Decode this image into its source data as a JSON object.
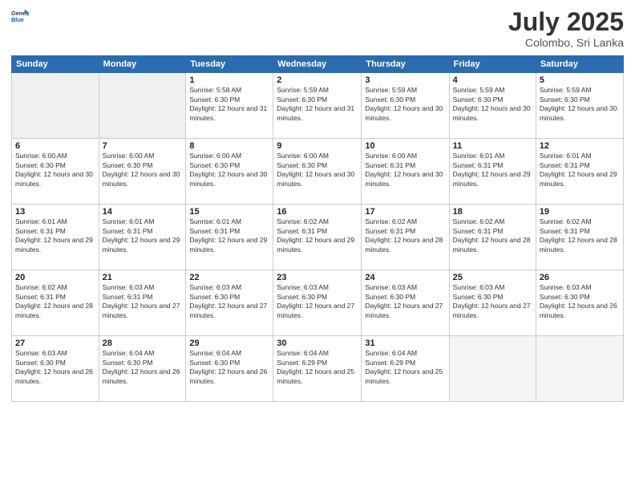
{
  "header": {
    "logo_general": "General",
    "logo_blue": "Blue",
    "month_title": "July 2025",
    "location": "Colombo, Sri Lanka"
  },
  "weekdays": [
    "Sunday",
    "Monday",
    "Tuesday",
    "Wednesday",
    "Thursday",
    "Friday",
    "Saturday"
  ],
  "weeks": [
    [
      {
        "day": "",
        "info": "",
        "empty": true
      },
      {
        "day": "",
        "info": "",
        "empty": true
      },
      {
        "day": "1",
        "info": "Sunrise: 5:58 AM\nSunset: 6:30 PM\nDaylight: 12 hours and 31 minutes."
      },
      {
        "day": "2",
        "info": "Sunrise: 5:59 AM\nSunset: 6:30 PM\nDaylight: 12 hours and 31 minutes."
      },
      {
        "day": "3",
        "info": "Sunrise: 5:59 AM\nSunset: 6:30 PM\nDaylight: 12 hours and 30 minutes."
      },
      {
        "day": "4",
        "info": "Sunrise: 5:59 AM\nSunset: 6:30 PM\nDaylight: 12 hours and 30 minutes."
      },
      {
        "day": "5",
        "info": "Sunrise: 5:59 AM\nSunset: 6:30 PM\nDaylight: 12 hours and 30 minutes."
      }
    ],
    [
      {
        "day": "6",
        "info": "Sunrise: 6:00 AM\nSunset: 6:30 PM\nDaylight: 12 hours and 30 minutes."
      },
      {
        "day": "7",
        "info": "Sunrise: 6:00 AM\nSunset: 6:30 PM\nDaylight: 12 hours and 30 minutes."
      },
      {
        "day": "8",
        "info": "Sunrise: 6:00 AM\nSunset: 6:30 PM\nDaylight: 12 hours and 30 minutes."
      },
      {
        "day": "9",
        "info": "Sunrise: 6:00 AM\nSunset: 6:30 PM\nDaylight: 12 hours and 30 minutes."
      },
      {
        "day": "10",
        "info": "Sunrise: 6:00 AM\nSunset: 6:31 PM\nDaylight: 12 hours and 30 minutes."
      },
      {
        "day": "11",
        "info": "Sunrise: 6:01 AM\nSunset: 6:31 PM\nDaylight: 12 hours and 29 minutes."
      },
      {
        "day": "12",
        "info": "Sunrise: 6:01 AM\nSunset: 6:31 PM\nDaylight: 12 hours and 29 minutes."
      }
    ],
    [
      {
        "day": "13",
        "info": "Sunrise: 6:01 AM\nSunset: 6:31 PM\nDaylight: 12 hours and 29 minutes."
      },
      {
        "day": "14",
        "info": "Sunrise: 6:01 AM\nSunset: 6:31 PM\nDaylight: 12 hours and 29 minutes."
      },
      {
        "day": "15",
        "info": "Sunrise: 6:01 AM\nSunset: 6:31 PM\nDaylight: 12 hours and 29 minutes."
      },
      {
        "day": "16",
        "info": "Sunrise: 6:02 AM\nSunset: 6:31 PM\nDaylight: 12 hours and 29 minutes."
      },
      {
        "day": "17",
        "info": "Sunrise: 6:02 AM\nSunset: 6:31 PM\nDaylight: 12 hours and 28 minutes."
      },
      {
        "day": "18",
        "info": "Sunrise: 6:02 AM\nSunset: 6:31 PM\nDaylight: 12 hours and 28 minutes."
      },
      {
        "day": "19",
        "info": "Sunrise: 6:02 AM\nSunset: 6:31 PM\nDaylight: 12 hours and 28 minutes."
      }
    ],
    [
      {
        "day": "20",
        "info": "Sunrise: 6:02 AM\nSunset: 6:31 PM\nDaylight: 12 hours and 28 minutes."
      },
      {
        "day": "21",
        "info": "Sunrise: 6:03 AM\nSunset: 6:31 PM\nDaylight: 12 hours and 27 minutes."
      },
      {
        "day": "22",
        "info": "Sunrise: 6:03 AM\nSunset: 6:30 PM\nDaylight: 12 hours and 27 minutes."
      },
      {
        "day": "23",
        "info": "Sunrise: 6:03 AM\nSunset: 6:30 PM\nDaylight: 12 hours and 27 minutes."
      },
      {
        "day": "24",
        "info": "Sunrise: 6:03 AM\nSunset: 6:30 PM\nDaylight: 12 hours and 27 minutes."
      },
      {
        "day": "25",
        "info": "Sunrise: 6:03 AM\nSunset: 6:30 PM\nDaylight: 12 hours and 27 minutes."
      },
      {
        "day": "26",
        "info": "Sunrise: 6:03 AM\nSunset: 6:30 PM\nDaylight: 12 hours and 26 minutes."
      }
    ],
    [
      {
        "day": "27",
        "info": "Sunrise: 6:03 AM\nSunset: 6:30 PM\nDaylight: 12 hours and 26 minutes."
      },
      {
        "day": "28",
        "info": "Sunrise: 6:04 AM\nSunset: 6:30 PM\nDaylight: 12 hours and 26 minutes."
      },
      {
        "day": "29",
        "info": "Sunrise: 6:04 AM\nSunset: 6:30 PM\nDaylight: 12 hours and 26 minutes."
      },
      {
        "day": "30",
        "info": "Sunrise: 6:04 AM\nSunset: 6:29 PM\nDaylight: 12 hours and 25 minutes."
      },
      {
        "day": "31",
        "info": "Sunrise: 6:04 AM\nSunset: 6:29 PM\nDaylight: 12 hours and 25 minutes."
      },
      {
        "day": "",
        "info": "",
        "empty": true
      },
      {
        "day": "",
        "info": "",
        "empty": true
      }
    ]
  ]
}
